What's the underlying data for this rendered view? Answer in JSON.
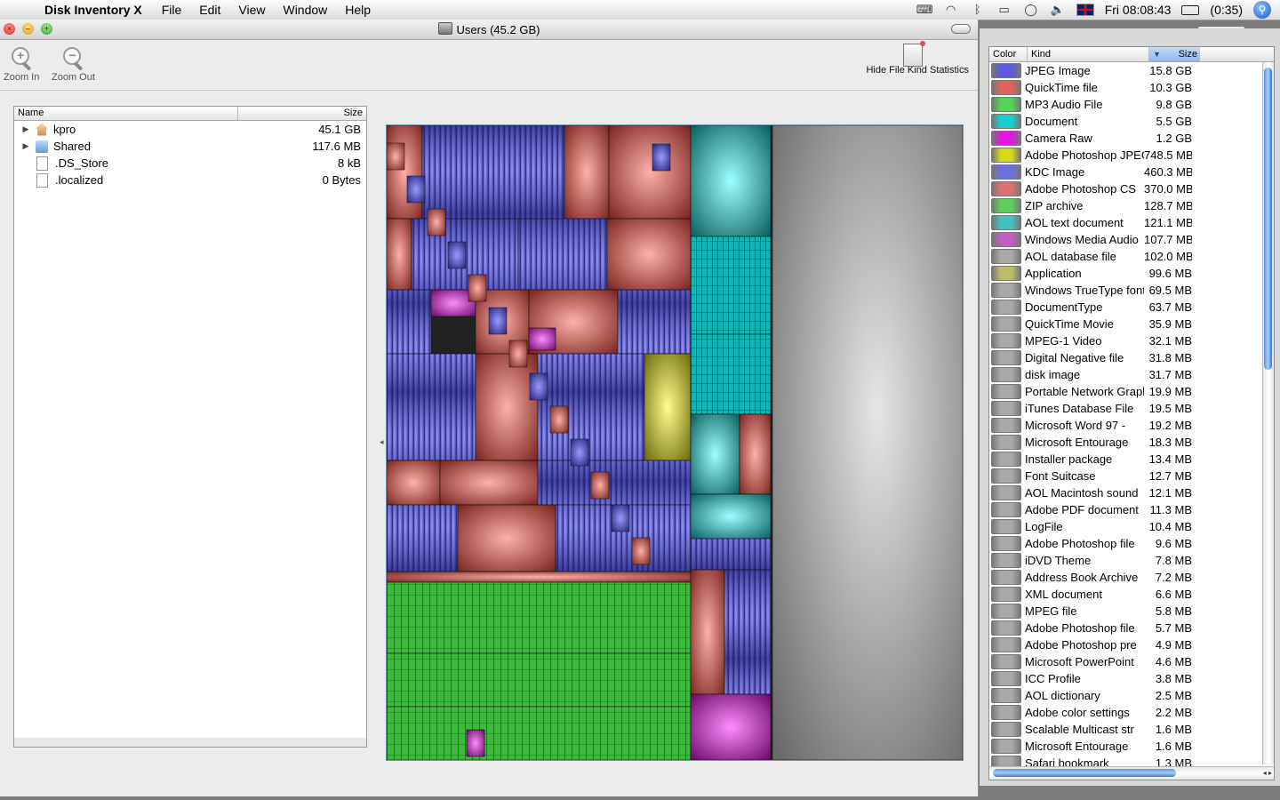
{
  "menubar": {
    "app_name": "Disk Inventory X",
    "items": [
      "File",
      "Edit",
      "View",
      "Window",
      "Help"
    ],
    "clock": "Fri 08:08:43",
    "battery": "(0:35)"
  },
  "window": {
    "title": "Users (45.2 GB)",
    "toolbar": {
      "zoom_in": "Zoom In",
      "zoom_out": "Zoom Out",
      "hide_stats": "Hide File Kind Statistics"
    }
  },
  "tree": {
    "col_name": "Name",
    "col_size": "Size",
    "rows": [
      {
        "name": "kpro",
        "size": "45.1 GB"
      },
      {
        "name": "Shared",
        "size": "117.6 MB"
      },
      {
        "name": ".DS_Store",
        "size": "8 kB"
      },
      {
        "name": ".localized",
        "size": "0 Bytes"
      }
    ]
  },
  "stats": {
    "col_color": "Color",
    "col_kind": "Kind",
    "col_size": "Size",
    "rows": [
      {
        "kind": "JPEG Image",
        "size": "15.8 GB",
        "color": "#5b5bdc"
      },
      {
        "kind": "QuickTime file",
        "size": "10.3 GB",
        "color": "#e0635b"
      },
      {
        "kind": "MP3 Audio File",
        "size": "9.8 GB",
        "color": "#52d452"
      },
      {
        "kind": "Document",
        "size": "5.5 GB",
        "color": "#18cfcf"
      },
      {
        "kind": "Camera Raw",
        "size": "1.2 GB",
        "color": "#e018e0"
      },
      {
        "kind": "Adobe Photoshop JPEG",
        "size": "748.5 MB",
        "color": "#d8d81a"
      },
      {
        "kind": "KDC Image",
        "size": "460.3 MB",
        "color": "#6f6fdc"
      },
      {
        "kind": "Adobe Photoshop CS",
        "size": "370.0 MB",
        "color": "#e07070"
      },
      {
        "kind": "ZIP archive",
        "size": "128.7 MB",
        "color": "#60cc60"
      },
      {
        "kind": "AOL text document",
        "size": "121.1 MB",
        "color": "#40c0c0"
      },
      {
        "kind": "Windows Media Audio",
        "size": "107.7 MB",
        "color": "#c060c0"
      },
      {
        "kind": "AOL database file",
        "size": "102.0 MB",
        "color": "#a8a8a8"
      },
      {
        "kind": "Application",
        "size": "99.6 MB",
        "color": "#bcbc6a"
      },
      {
        "kind": "Windows TrueType font",
        "size": "69.5 MB",
        "color": "#a8a8a8"
      },
      {
        "kind": "DocumentType",
        "size": "63.7 MB",
        "color": "#a8a8a8"
      },
      {
        "kind": "QuickTime Movie",
        "size": "35.9 MB",
        "color": "#a8a8a8"
      },
      {
        "kind": "MPEG-1 Video",
        "size": "32.1 MB",
        "color": "#a8a8a8"
      },
      {
        "kind": "Digital Negative file",
        "size": "31.8 MB",
        "color": "#a8a8a8"
      },
      {
        "kind": "disk image",
        "size": "31.7 MB",
        "color": "#a8a8a8"
      },
      {
        "kind": "Portable Network Graphics",
        "size": "19.9 MB",
        "color": "#a8a8a8"
      },
      {
        "kind": "iTunes Database File",
        "size": "19.5 MB",
        "color": "#a8a8a8"
      },
      {
        "kind": "Microsoft Word 97 - ",
        "size": "19.2 MB",
        "color": "#a8a8a8"
      },
      {
        "kind": "Microsoft Entourage",
        "size": "18.3 MB",
        "color": "#a8a8a8"
      },
      {
        "kind": "Installer package",
        "size": "13.4 MB",
        "color": "#a8a8a8"
      },
      {
        "kind": "Font Suitcase",
        "size": "12.7 MB",
        "color": "#a8a8a8"
      },
      {
        "kind": "AOL Macintosh sound",
        "size": "12.1 MB",
        "color": "#a8a8a8"
      },
      {
        "kind": "Adobe PDF document",
        "size": "11.3 MB",
        "color": "#a8a8a8"
      },
      {
        "kind": "LogFile",
        "size": "10.4 MB",
        "color": "#a8a8a8"
      },
      {
        "kind": "Adobe Photoshop file",
        "size": "9.6 MB",
        "color": "#a8a8a8"
      },
      {
        "kind": "iDVD Theme",
        "size": "7.8 MB",
        "color": "#a8a8a8"
      },
      {
        "kind": "Address Book Archive",
        "size": "7.2 MB",
        "color": "#a8a8a8"
      },
      {
        "kind": "XML document",
        "size": "6.6 MB",
        "color": "#a8a8a8"
      },
      {
        "kind": "MPEG file",
        "size": "5.8 MB",
        "color": "#a8a8a8"
      },
      {
        "kind": "Adobe Photoshop file",
        "size": "5.7 MB",
        "color": "#a8a8a8"
      },
      {
        "kind": "Adobe Photoshop pre",
        "size": "4.9 MB",
        "color": "#a8a8a8"
      },
      {
        "kind": "Microsoft PowerPoint",
        "size": "4.6 MB",
        "color": "#a8a8a8"
      },
      {
        "kind": "ICC Profile",
        "size": "3.8 MB",
        "color": "#a8a8a8"
      },
      {
        "kind": "AOL dictionary",
        "size": "2.5 MB",
        "color": "#a8a8a8"
      },
      {
        "kind": "Adobe color settings",
        "size": "2.2 MB",
        "color": "#a8a8a8"
      },
      {
        "kind": "Scalable Multicast str",
        "size": "1.6 MB",
        "color": "#a8a8a8"
      },
      {
        "kind": "Microsoft Entourage",
        "size": "1.6 MB",
        "color": "#a8a8a8"
      },
      {
        "kind": "Safari bookmark",
        "size": "1.3 MB",
        "color": "#a8a8a8"
      }
    ]
  },
  "treemap": {
    "colors": {
      "jpeg": "#5151d8",
      "quicktime": "#d45c55",
      "mp3": "#40c640",
      "document": "#12c8c8",
      "raw": "#d818d8",
      "psjpeg": "#c8c818",
      "free": "#9a9a9a"
    }
  }
}
